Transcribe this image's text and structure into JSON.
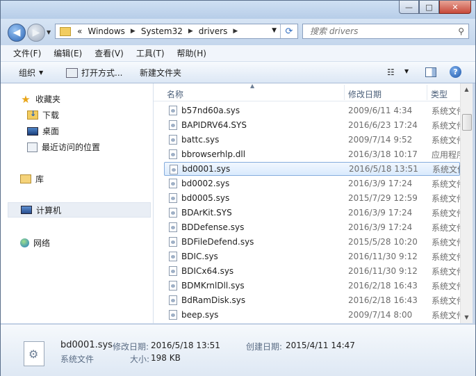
{
  "window": {
    "controls": {
      "minimize": "—",
      "maximize": "□",
      "close": "✕"
    }
  },
  "nav": {
    "address": {
      "prefix": "«",
      "crumbs": [
        "Windows",
        "System32",
        "drivers"
      ]
    },
    "search_placeholder": "搜索 drivers"
  },
  "menubar": {
    "items": [
      "文件(F)",
      "编辑(E)",
      "查看(V)",
      "工具(T)",
      "帮助(H)"
    ]
  },
  "toolbar": {
    "organize": "组织",
    "open_with": "打开方式...",
    "new_folder": "新建文件夹"
  },
  "navpane": {
    "favorites": "收藏夹",
    "downloads": "下载",
    "desktop": "桌面",
    "recent": "最近访问的位置",
    "libraries": "库",
    "computer": "计算机",
    "network": "网络"
  },
  "columns": {
    "name": "名称",
    "date": "修改日期",
    "type": "类型"
  },
  "files": [
    {
      "name": "b57nd60a.sys",
      "date": "2009/6/11 4:34",
      "type": "系统文件"
    },
    {
      "name": "BAPIDRV64.SYS",
      "date": "2016/6/23 17:24",
      "type": "系统文件"
    },
    {
      "name": "battc.sys",
      "date": "2009/7/14 9:52",
      "type": "系统文件"
    },
    {
      "name": "bbrowserhlp.dll",
      "date": "2016/3/18 10:17",
      "type": "应用程序扩展"
    },
    {
      "name": "bd0001.sys",
      "date": "2016/5/18 13:51",
      "type": "系统文件"
    },
    {
      "name": "bd0002.sys",
      "date": "2016/3/9 17:24",
      "type": "系统文件"
    },
    {
      "name": "bd0005.sys",
      "date": "2015/7/29 12:59",
      "type": "系统文件"
    },
    {
      "name": "BDArKit.SYS",
      "date": "2016/3/9 17:24",
      "type": "系统文件"
    },
    {
      "name": "BDDefense.sys",
      "date": "2016/3/9 17:24",
      "type": "系统文件"
    },
    {
      "name": "BDFileDefend.sys",
      "date": "2015/5/28 10:20",
      "type": "系统文件"
    },
    {
      "name": "BDIC.sys",
      "date": "2016/11/30 9:12",
      "type": "系统文件"
    },
    {
      "name": "BDICx64.sys",
      "date": "2016/11/30 9:12",
      "type": "系统文件"
    },
    {
      "name": "BDMKrnlDll.sys",
      "date": "2016/2/18 16:43",
      "type": "系统文件"
    },
    {
      "name": "BdRamDisk.sys",
      "date": "2016/2/18 16:43",
      "type": "系统文件"
    },
    {
      "name": "beep.sys",
      "date": "2009/7/14 8:00",
      "type": "系统文件"
    }
  ],
  "selected_index": 4,
  "details": {
    "filename": "bd0001.sys",
    "modified_label": "修改日期:",
    "modified_value": "2016/5/18 13:51",
    "created_label": "创建日期:",
    "created_value": "2015/4/11 14:47",
    "filetype": "系统文件",
    "size_label": "大小:",
    "size_value": "198 KB"
  }
}
